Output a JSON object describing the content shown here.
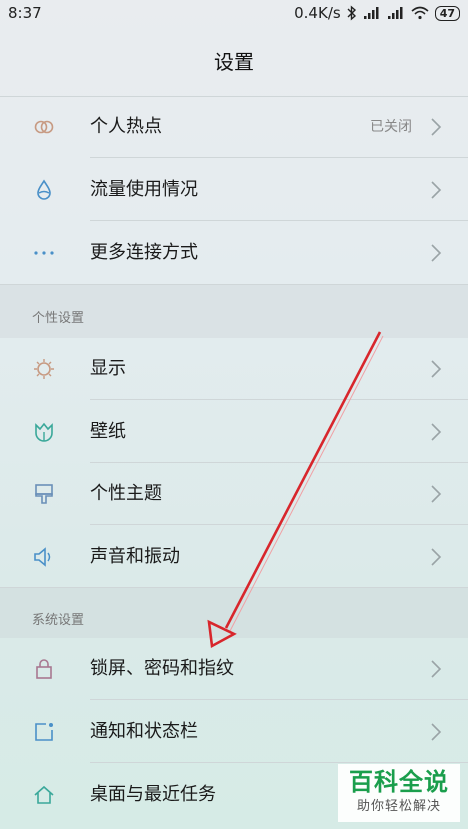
{
  "status_bar": {
    "time": "8:37",
    "speed": "0.4K/s",
    "battery": "47"
  },
  "title": "设置",
  "sections": [
    {
      "title": "",
      "items": [
        {
          "label": "个人热点",
          "value": "已关闭",
          "icon": "hotspot-icon"
        },
        {
          "label": "流量使用情况",
          "value": "",
          "icon": "data-drop-icon"
        },
        {
          "label": "更多连接方式",
          "value": "",
          "icon": "more-dots-icon"
        }
      ]
    },
    {
      "title": "个性设置",
      "items": [
        {
          "label": "显示",
          "value": "",
          "icon": "sun-icon"
        },
        {
          "label": "壁纸",
          "value": "",
          "icon": "tulip-icon"
        },
        {
          "label": "个性主题",
          "value": "",
          "icon": "brush-icon"
        },
        {
          "label": "声音和振动",
          "value": "",
          "icon": "speaker-icon"
        }
      ]
    },
    {
      "title": "系统设置",
      "items": [
        {
          "label": "锁屏、密码和指纹",
          "value": "",
          "icon": "lock-icon"
        },
        {
          "label": "通知和状态栏",
          "value": "",
          "icon": "notification-icon"
        },
        {
          "label": "桌面与最近任务",
          "value": "",
          "icon": "home-icon"
        }
      ]
    }
  ],
  "watermark": {
    "title": "百科全说",
    "subtitle": "助你轻松解决"
  },
  "colors": {
    "accent_green": "#1a9e4c",
    "arrow_red": "#d8262c",
    "icon_gray": "#7a8a90"
  }
}
